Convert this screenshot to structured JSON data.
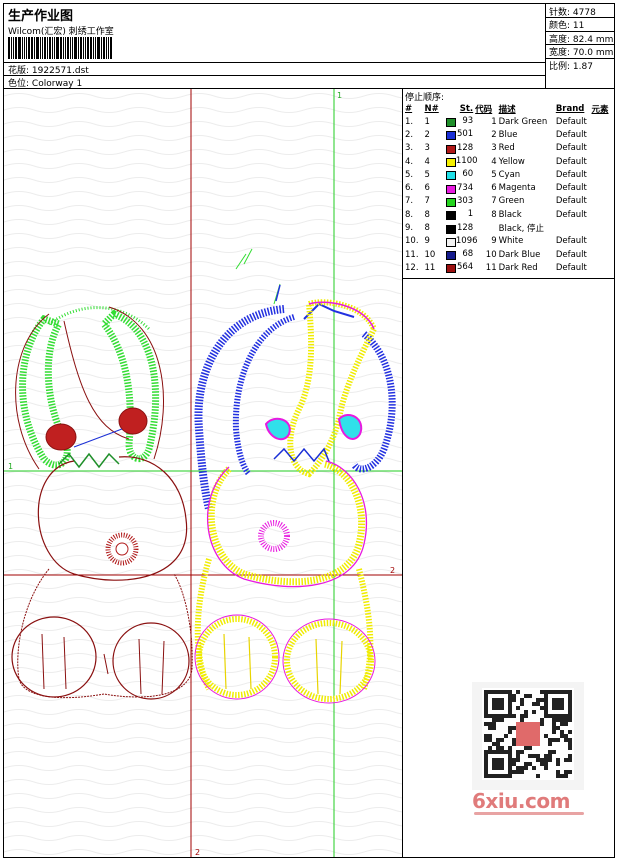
{
  "header": {
    "title": "生产作业图",
    "company": "Wilcom(汇宏) 刺绣工作室",
    "pattern_label": "花版:",
    "pattern_value": "1922571.dst",
    "colorway_label": "色位:",
    "colorway_value": "Colorway 1"
  },
  "stats": {
    "stitches_label": "针数:",
    "stitches_value": "4778",
    "colors_label": "颜色:",
    "colors_value": "11",
    "height_label": "高度:",
    "height_value": "82.4 mm",
    "width_label": "宽度:",
    "width_value": "70.0 mm",
    "scale_label": "比例:",
    "scale_value": "1.87"
  },
  "design": {
    "marker_v1": "1",
    "marker_h1": "1",
    "marker_h2": "2",
    "marker_v2": "2"
  },
  "stops": {
    "title": "停止顺序:",
    "columns": [
      "#",
      "N#",
      "St.",
      "代码",
      "描述",
      "Brand",
      "元素"
    ],
    "rows": [
      {
        "idx": "1.",
        "n": "1",
        "color": "#1f8f2a",
        "st": "93",
        "code": "1",
        "desc": "Dark Green",
        "brand": "Default"
      },
      {
        "idx": "2.",
        "n": "2",
        "color": "#1a2fd6",
        "st": "501",
        "code": "2",
        "desc": "Blue",
        "brand": "Default"
      },
      {
        "idx": "3.",
        "n": "3",
        "color": "#b01818",
        "st": "128",
        "code": "3",
        "desc": "Red",
        "brand": "Default"
      },
      {
        "idx": "4.",
        "n": "4",
        "color": "#f5f000",
        "st": "1100",
        "code": "4",
        "desc": "Yellow",
        "brand": "Default"
      },
      {
        "idx": "5.",
        "n": "5",
        "color": "#20e0e8",
        "st": "60",
        "code": "5",
        "desc": "Cyan",
        "brand": "Default"
      },
      {
        "idx": "6.",
        "n": "6",
        "color": "#e81ae0",
        "st": "734",
        "code": "6",
        "desc": "Magenta",
        "brand": "Default"
      },
      {
        "idx": "7.",
        "n": "7",
        "color": "#24d41e",
        "st": "303",
        "code": "7",
        "desc": "Green",
        "brand": "Default"
      },
      {
        "idx": "8.",
        "n": "8",
        "color": "#000000",
        "st": "1",
        "code": "8",
        "desc": "Black",
        "brand": "Default"
      },
      {
        "idx": "9.",
        "n": "8",
        "color": "#000000",
        "st": "128",
        "code": "",
        "desc": "Black, 停止",
        "brand": ""
      },
      {
        "idx": "10.",
        "n": "9",
        "color": "#f2f2f2",
        "st": "1096",
        "code": "9",
        "desc": "White",
        "brand": "Default"
      },
      {
        "idx": "11.",
        "n": "10",
        "color": "#141a8c",
        "st": "68",
        "code": "10",
        "desc": "Dark Blue",
        "brand": "Default"
      },
      {
        "idx": "12.",
        "n": "11",
        "color": "#9c1010",
        "st": "564",
        "code": "11",
        "desc": "Dark Red",
        "brand": "Default"
      }
    ]
  },
  "watermark": {
    "site": "6xiu.com"
  }
}
